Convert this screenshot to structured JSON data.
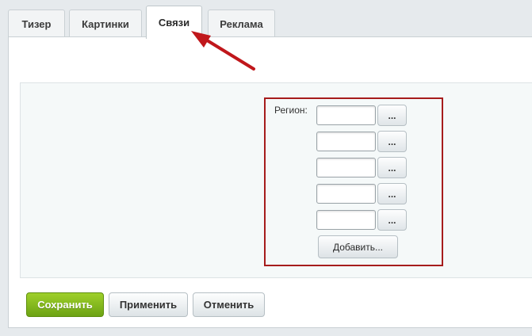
{
  "tabs": [
    {
      "label": "Тизер",
      "active": false
    },
    {
      "label": "Картинки",
      "active": false
    },
    {
      "label": "Связи",
      "active": true
    },
    {
      "label": "Реклама",
      "active": false
    }
  ],
  "region": {
    "label": "Регион:",
    "inputs": [
      "",
      "",
      "",
      "",
      ""
    ],
    "browse_label": "...",
    "add_label": "Добавить..."
  },
  "actions": {
    "save_label": "Сохранить",
    "apply_label": "Применить",
    "cancel_label": "Отменить"
  },
  "colors": {
    "annotation_red": "#c0171b",
    "save_green": "#7bb61c",
    "highlight_border": "#a61c1c"
  }
}
